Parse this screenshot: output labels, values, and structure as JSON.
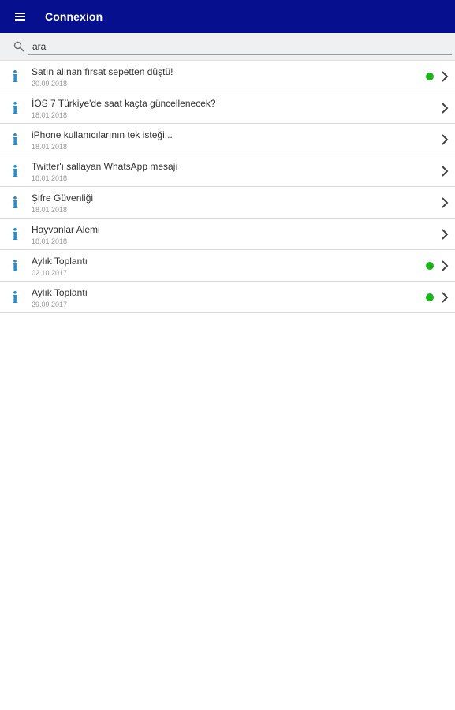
{
  "appbar": {
    "title": "Connexion"
  },
  "search": {
    "value": "ara"
  },
  "colors": {
    "appbar": "#06108e",
    "accent": "#1d8fd8",
    "unread_dot": "#18b816"
  },
  "items": [
    {
      "title": "Satın alınan fırsat sepetten düştü!",
      "date": "20.09.2018",
      "unread": true
    },
    {
      "title": "İOS 7 Türkiye'de saat kaçta güncellenecek?",
      "date": "18.01.2018",
      "unread": false
    },
    {
      "title": "iPhone kullanıcılarının tek isteği...",
      "date": "18.01.2018",
      "unread": false
    },
    {
      "title": "Twitter'ı sallayan WhatsApp mesajı",
      "date": "18.01.2018",
      "unread": false
    },
    {
      "title": "Şifre Güvenliği",
      "date": "18.01.2018",
      "unread": false
    },
    {
      "title": "Hayvanlar Alemi",
      "date": "18.01.2018",
      "unread": false
    },
    {
      "title": "Aylık Toplantı",
      "date": "02.10.2017",
      "unread": true
    },
    {
      "title": "Aylık Toplantı",
      "date": "29.09.2017",
      "unread": true
    }
  ]
}
